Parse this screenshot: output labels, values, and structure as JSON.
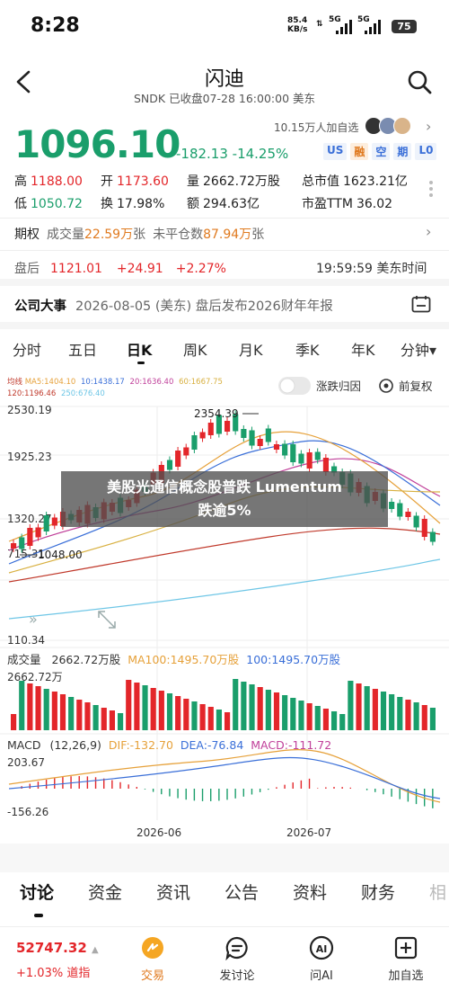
{
  "status_bar": {
    "time": "8:28",
    "net_speed": "85.4",
    "net_unit": "KB/s",
    "sig1": "5G",
    "sig2": "5G",
    "battery": "75"
  },
  "header": {
    "title": "闪迪",
    "subtitle": "SNDK 已收盘07-28 16:00:00 美东"
  },
  "quote": {
    "price": "1096.10",
    "change": "-182.13 -14.25%",
    "watchers": "10.15万人加自选",
    "tags": [
      "US",
      "融",
      "空",
      "期",
      "L0"
    ]
  },
  "stats": {
    "high_k": "高",
    "high_v": "1188.00",
    "open_k": "开",
    "open_v": "1173.60",
    "volume_k": "量",
    "volume_v": "2662.72万股",
    "mktcap_k": "总市值",
    "mktcap_v": "1623.21亿",
    "low_k": "低",
    "low_v": "1050.72",
    "turnover_k": "换",
    "turnover_v": "17.98%",
    "amount_k": "额",
    "amount_v": "294.63亿",
    "pe_k": "市盈TTM",
    "pe_v": "36.02"
  },
  "options": {
    "label": "期权",
    "vol_label": "成交量",
    "vol_value": "22.59万",
    "vol_unit": "张",
    "oi_label": "未平仓数",
    "oi_value": "87.94万",
    "oi_unit": "张"
  },
  "after_hours": {
    "label": "盘后",
    "price": "1121.01",
    "change": "+24.91",
    "pct": "+2.27%",
    "time": "19:59:59 美东时间"
  },
  "event": {
    "label": "公司大事",
    "text": "2026-08-05 (美东) 盘后发布2026财年年报"
  },
  "period_tabs": [
    "分时",
    "五日",
    "日K",
    "周K",
    "月K",
    "季K",
    "年K",
    "分钟▾"
  ],
  "chart": {
    "ma_legend": {
      "label_k": "均线",
      "ma5": "MA5:1404.10",
      "ma10": "10:1438.17",
      "ma20": "20:1636.40",
      "ma60": "60:1667.75",
      "ma120": "120:1196.46",
      "ma250": "250:676.40"
    },
    "toggle_label": "涨跌归因",
    "adjust_label": "前复权",
    "y_labels": [
      "2530.19",
      "1925.23",
      "1320.27",
      "715.31",
      "110.34"
    ],
    "high_label": "2354.39",
    "low_label": "1048.00",
    "volume": {
      "title": "成交量",
      "value": "2662.72万股",
      "ma100": "MA100:1495.70万股",
      "ma100b": "100:1495.70万股",
      "max_label": "2662.72万"
    },
    "macd": {
      "title": "MACD",
      "params": "(12,26,9)",
      "dif": "DIF:-132.70",
      "dea": "DEA:-76.84",
      "macd": "MACD:-111.72",
      "top": "203.67",
      "bottom": "-156.26"
    },
    "x_labels": [
      "2026-06",
      "2026-07"
    ],
    "colors": {
      "up": "#e3262a",
      "down": "#1a9e6b",
      "ma5": "#e6a13a",
      "ma10": "#3a6fd8",
      "ma20": "#c0409a",
      "ma60": "#d8b040",
      "ma120": "#c0392b",
      "ma250": "#6ec6e6"
    }
  },
  "banner": {
    "line1": "美股光通信概念股普跌 Lumentum",
    "line2": "跌逾5%"
  },
  "bottom_tabs": [
    "讨论",
    "资金",
    "资讯",
    "公告",
    "资料",
    "财务",
    "相"
  ],
  "footer": {
    "index_value": "52747.32",
    "index_arrow": "▲",
    "index_change": "+1.03% 道指",
    "buttons": [
      {
        "label": "交易",
        "icon": "trade-icon"
      },
      {
        "label": "发讨论",
        "icon": "discuss-icon"
      },
      {
        "label": "问AI",
        "icon": "ai-icon"
      },
      {
        "label": "加自选",
        "icon": "add-watchlist-icon"
      }
    ]
  }
}
